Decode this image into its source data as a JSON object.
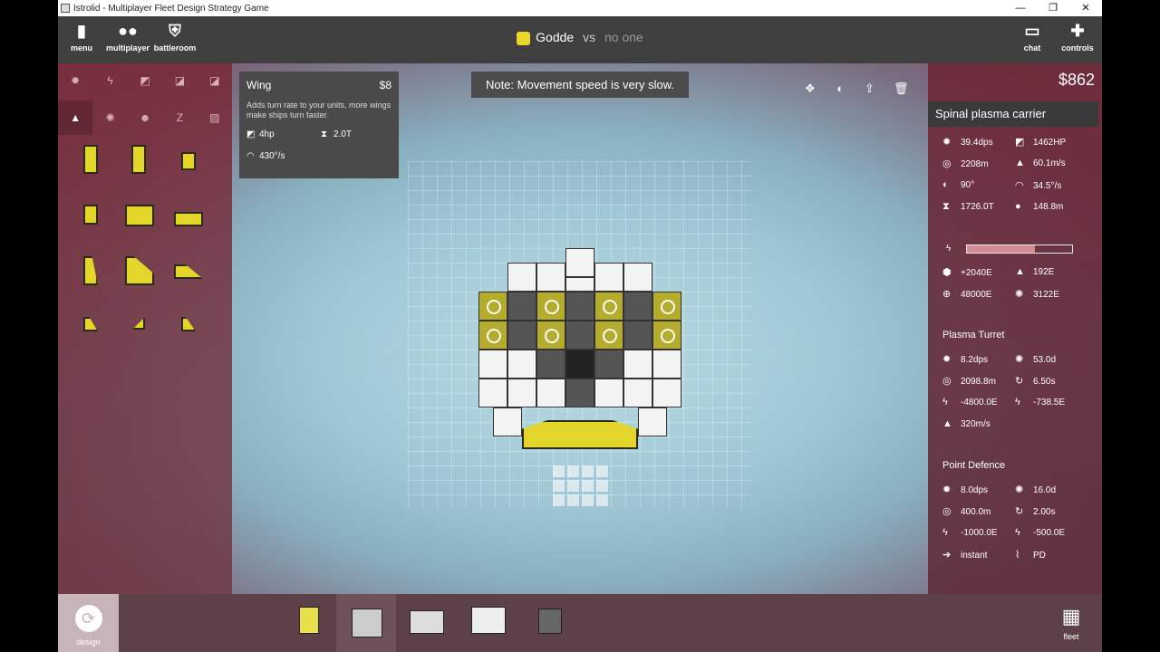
{
  "window": {
    "title": "Istrolid - Multiplayer Fleet Design Strategy Game",
    "controls": [
      "—",
      "❐",
      "✕"
    ]
  },
  "topbar": {
    "menu": {
      "label": "menu",
      "icon": "menu-icon"
    },
    "multiplayer": {
      "label": "multiplayer",
      "icon": "multiplayer-icon"
    },
    "battleroom": {
      "label": "battleroom",
      "icon": "battleroom-icon"
    },
    "player": "Godde",
    "vs": "vs",
    "opponent": "no one",
    "chat": {
      "label": "chat",
      "icon": "chat-icon"
    },
    "controls": {
      "label": "controls",
      "icon": "controls-icon"
    }
  },
  "note": "Note: Movement speed is very slow.",
  "tooltip": {
    "name": "Wing",
    "price": "$8",
    "desc": "Adds turn rate to your units, more wings make ships turn faster.",
    "hp": "4hp",
    "mass": "2.0T",
    "turn": "430°/s"
  },
  "right": {
    "money": "$862",
    "ship_name": "Spinal plasma carrier",
    "stats": [
      [
        "39.4dps",
        "1462HP"
      ],
      [
        "2208m",
        "60.1m/s"
      ],
      [
        "90°",
        "34.5°/s"
      ],
      [
        "1726.0T",
        "148.8m"
      ]
    ],
    "energy": [
      [
        "+2040E",
        "192E"
      ],
      [
        "48000E",
        "3122E"
      ]
    ],
    "energy_fill": 0.65,
    "plasma_turret": {
      "title": "Plasma Turret",
      "stats": [
        [
          "8.2dps",
          "53.0d"
        ],
        [
          "2098.8m",
          "6.50s"
        ],
        [
          "-4800.0E",
          "-738.5E"
        ],
        [
          "320m/s",
          ""
        ]
      ]
    },
    "point_defence": {
      "title": "Point Defence",
      "stats": [
        [
          "8.0dps",
          "16.0d"
        ],
        [
          "400.0m",
          "2.00s"
        ],
        [
          "-1000.0E",
          "-500.0E"
        ],
        [
          "instant",
          "PD"
        ]
      ]
    }
  },
  "bottom": {
    "design": "design",
    "fleet": "fleet"
  },
  "colors": {
    "accent": "#e3d52a",
    "panel": "#7b2f43"
  }
}
